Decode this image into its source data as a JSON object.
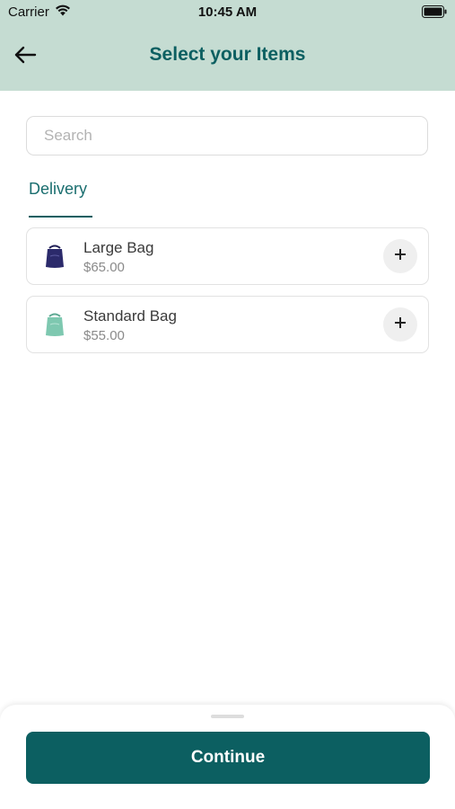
{
  "status_bar": {
    "carrier": "Carrier",
    "time": "10:45 AM"
  },
  "header": {
    "title": "Select your Items",
    "back_icon": "arrow-left-icon"
  },
  "search": {
    "placeholder": "Search",
    "value": ""
  },
  "tabs": [
    {
      "label": "Delivery",
      "active": true
    }
  ],
  "items": [
    {
      "name": "Large Bag",
      "price": "$65.00",
      "icon": "large-bag-icon",
      "color": "#2b2a6b"
    },
    {
      "name": "Standard Bag",
      "price": "$55.00",
      "icon": "standard-bag-icon",
      "color": "#7ec8b0"
    }
  ],
  "footer": {
    "continue_label": "Continue"
  },
  "colors": {
    "header_bg": "#c5dcd2",
    "accent": "#0c5f61"
  }
}
